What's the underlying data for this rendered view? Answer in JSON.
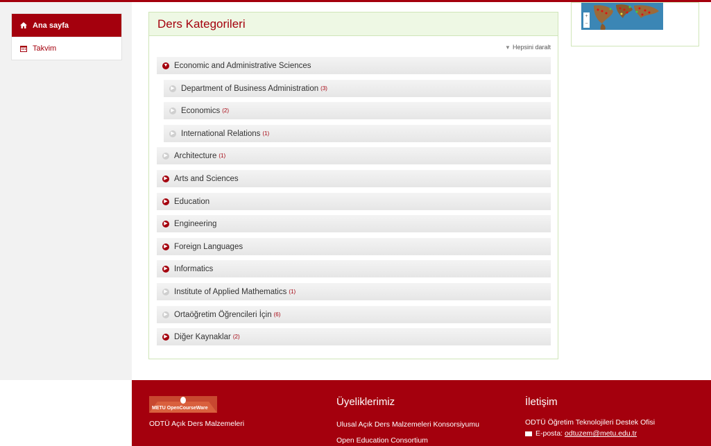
{
  "sidebar": {
    "items": [
      {
        "label": "Ana sayfa",
        "icon": "home-icon",
        "active": true
      },
      {
        "label": "Takvim",
        "icon": "calendar-icon",
        "active": false
      }
    ]
  },
  "panel": {
    "title": "Ders Kategorileri",
    "collapse_all": "Hepsini daralt"
  },
  "categories": [
    {
      "label": "Economic and Administrative Sciences",
      "count": "",
      "bullet": "expanded"
    },
    {
      "label": "Department of Business Administration",
      "count": "(3)",
      "bullet": "leaf"
    },
    {
      "label": "Economics",
      "count": "(2)",
      "bullet": "leaf"
    },
    {
      "label": "International Relations",
      "count": "(1)",
      "bullet": "leaf"
    },
    {
      "label": "Architecture",
      "count": "(1)",
      "bullet": "leaf"
    },
    {
      "label": "Arts and Sciences",
      "count": "",
      "bullet": "collapsed"
    },
    {
      "label": "Education",
      "count": "",
      "bullet": "collapsed"
    },
    {
      "label": "Engineering",
      "count": "",
      "bullet": "collapsed"
    },
    {
      "label": "Foreign Languages",
      "count": "",
      "bullet": "collapsed"
    },
    {
      "label": "Informatics",
      "count": "",
      "bullet": "collapsed"
    },
    {
      "label": "Institute of Applied Mathematics",
      "count": "(1)",
      "bullet": "leaf"
    },
    {
      "label": "Ortaöğretim Öğrencileri İçin",
      "count": "(6)",
      "bullet": "leaf"
    },
    {
      "label": "Diğer Kaynaklar",
      "count": "(2)",
      "bullet": "collapsed"
    }
  ],
  "map": {
    "zoom_in": "+",
    "zoom_out": "−"
  },
  "footer": {
    "logo_text": "METU OpenCourseWare",
    "left_text": "ODTÜ Açık Ders Malzemeleri",
    "memberships_title": "Üyeliklerimiz",
    "memberships": [
      "Ulusal Açık Ders Malzemeleri Konsorsiyumu",
      "Open Education Consortium"
    ],
    "contact_title": "İletişim",
    "contact_office": "ODTÜ Öğretim Teknolojileri Destek Ofisi",
    "contact_email_label": "E-posta:",
    "contact_email": "odtuzem@metu.edu.tr"
  },
  "colors": {
    "brand": "#a4000d",
    "panel_border": "#cfe5b8"
  }
}
